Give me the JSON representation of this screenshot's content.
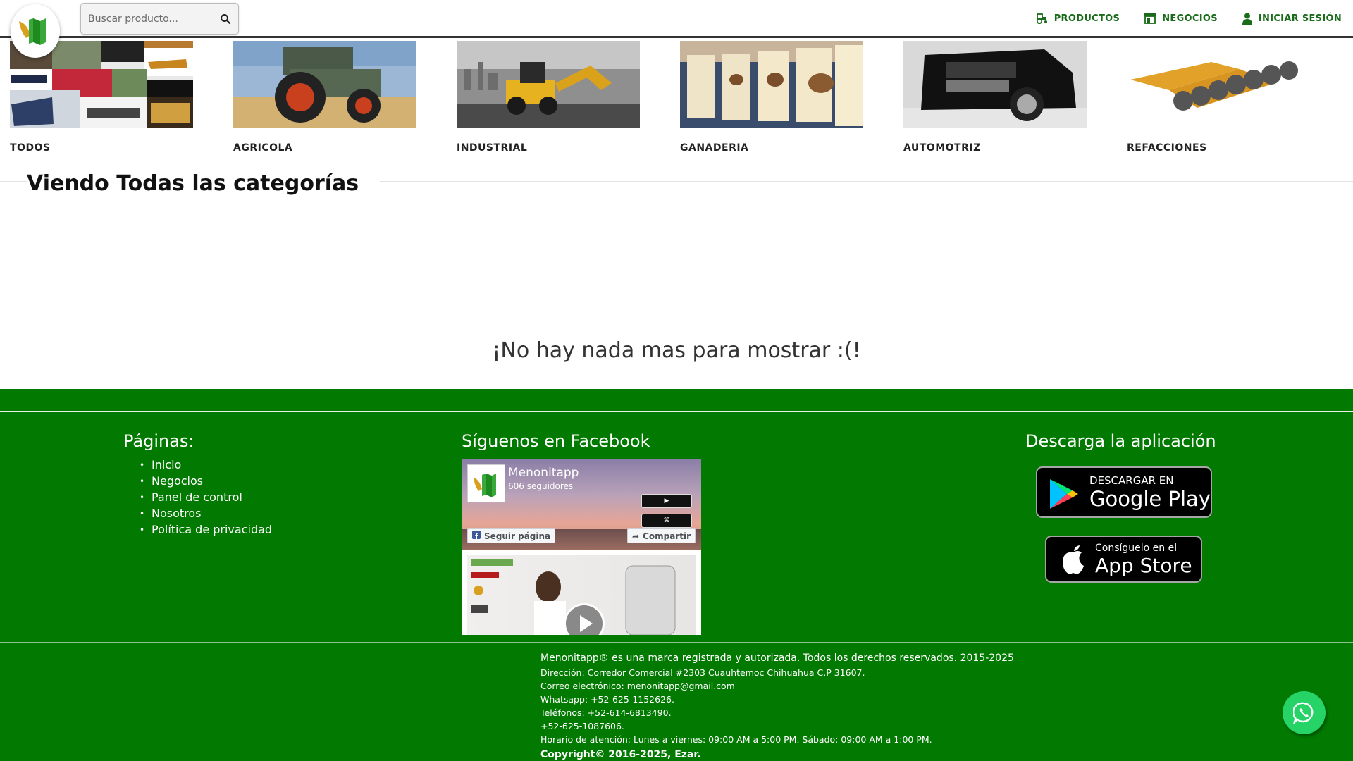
{
  "header": {
    "search_placeholder": "Buscar producto...",
    "nav": [
      {
        "label": "PRODUCTOS",
        "icon": "tractor-icon"
      },
      {
        "label": "NEGOCIOS",
        "icon": "store-icon"
      },
      {
        "label": "INICIAR SESIÓN",
        "icon": "user-icon"
      }
    ],
    "brand_color": "#1a6b1a"
  },
  "categories": [
    {
      "label": "TODOS",
      "image": "collage-image"
    },
    {
      "label": "AGRICOLA",
      "image": "tractor-image"
    },
    {
      "label": "INDUSTRIAL",
      "image": "backhoe-image"
    },
    {
      "label": "GANADERIA",
      "image": "cattle-image"
    },
    {
      "label": "AUTOMOTRIZ",
      "image": "suv-image"
    },
    {
      "label": "REFACCIONES",
      "image": "disc-harrow-image"
    }
  ],
  "main": {
    "title": "Viendo Todas las categorías",
    "empty_message": "¡No hay nada mas para mostrar :(!"
  },
  "footer": {
    "background": "#027a02",
    "pages": {
      "heading": "Páginas:",
      "items": [
        "Inicio",
        "Negocios",
        "Panel de control",
        "Nosotros",
        "Política de privacidad"
      ]
    },
    "facebook": {
      "heading": "Síguenos en Facebook",
      "page_name": "Menonitapp",
      "followers": "606 seguidores",
      "follow_label": "Seguir página",
      "share_label": "Compartir"
    },
    "app": {
      "heading": "Descarga la aplicación",
      "google_top": "DESCARGAR EN",
      "google_bottom": "Google Play",
      "apple_top": "Consíguelo en el",
      "apple_bottom": "App Store"
    },
    "legal": [
      "Menonitapp® es una marca registrada y autorizada. Todos los derechos reservados. 2015-2025",
      "Dirección: Corredor Comercial #2303 Cuauhtemoc Chihuahua C.P 31607.",
      "Correo electrónico: menonitapp@gmail.com",
      "Whatsapp: +52-625-1152626.",
      "Teléfonos: +52-614-6813490.",
      "+52-625-1087606.",
      "Horario de atención: Lunes a viernes: 09:00 AM a 5:00 PM. Sábado: 09:00 AM a 1:00 PM."
    ],
    "copyright": "Copyright© 2016-2025, Ezar."
  },
  "whatsapp": {
    "icon": "whatsapp-icon",
    "color": "#25d366"
  }
}
